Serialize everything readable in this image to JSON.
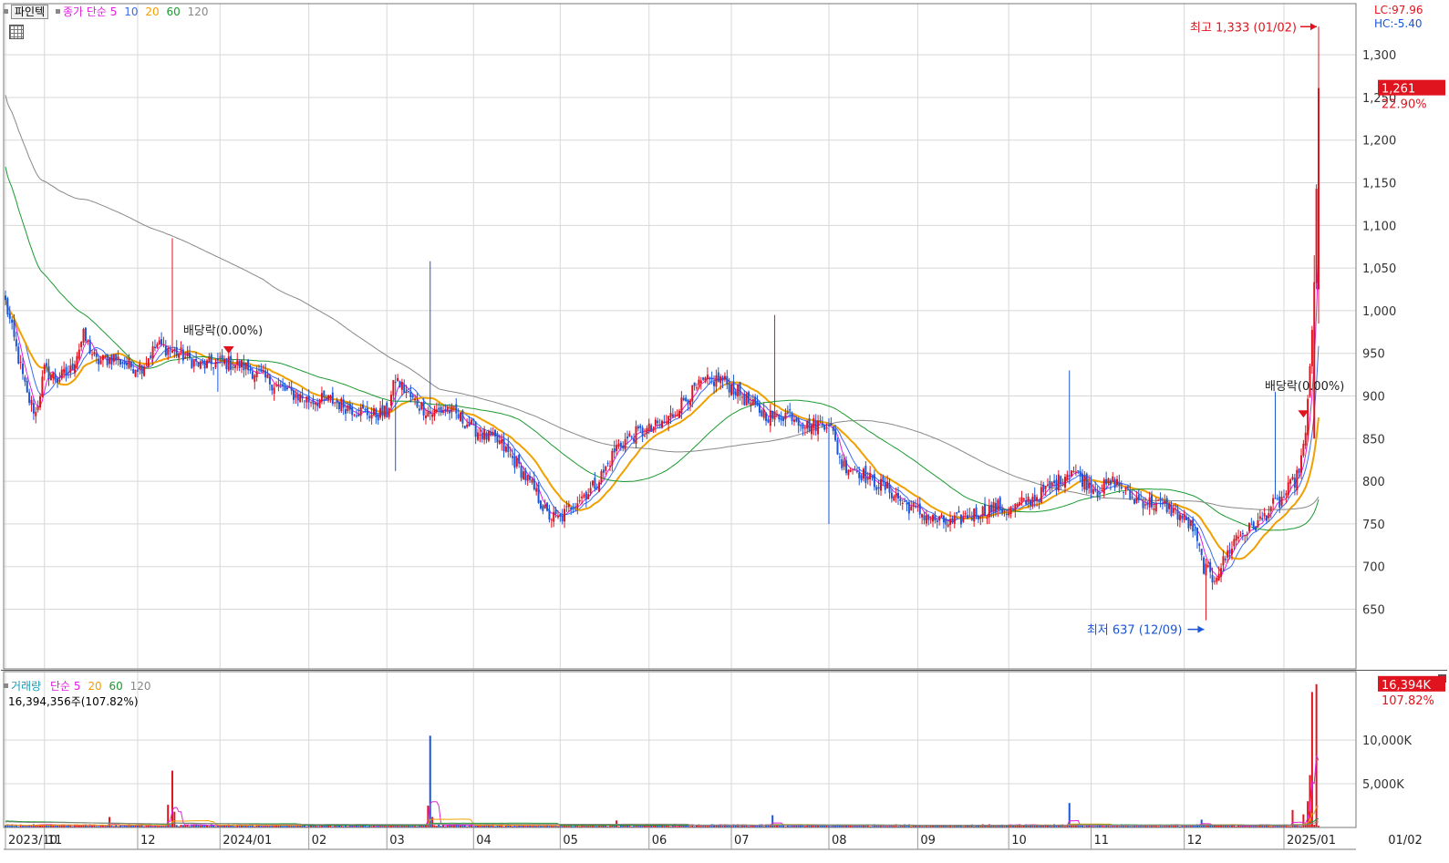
{
  "price_panel": {
    "tab_label": "파인텍",
    "legend_prefix": "종가 단순",
    "ma": [
      {
        "period": "5",
        "color": "#e020e0"
      },
      {
        "period": "10",
        "color": "#3a6cf0"
      },
      {
        "period": "20",
        "color": "#f0a000"
      },
      {
        "period": "60",
        "color": "#1a9a30"
      },
      {
        "period": "120",
        "color": "#888888"
      }
    ],
    "lc_text": "LC:97.96",
    "hc_text": "HC:-5.40",
    "current_price_label": "1,261",
    "current_change_label": "22.90%",
    "high_annotation": "최고 1,333 (01/02)",
    "low_annotation": "최저 637 (12/09)",
    "dividend_label_1": "배당락(0.00%)",
    "dividend_label_2": "배당락(0.00%)",
    "up_color": "#e0141e",
    "down_color": "#1a56d6"
  },
  "volume_panel": {
    "title": "거래량",
    "legend_prefix": "단순",
    "ma": [
      {
        "period": "5",
        "color": "#e020e0"
      },
      {
        "period": "20",
        "color": "#f0a000"
      },
      {
        "period": "60",
        "color": "#1a9a30"
      },
      {
        "period": "120",
        "color": "#888888"
      }
    ],
    "summary": "16,394,356주(107.82%)",
    "current_volume_label": "16,394K",
    "current_volume_change": "107.82%"
  },
  "chart_data": [
    {
      "type": "candlestick",
      "title": "파인텍",
      "y_ticks": [
        650,
        700,
        750,
        800,
        850,
        900,
        950,
        1000,
        1050,
        1100,
        1150,
        1200,
        1250,
        1300
      ],
      "y_tick_labels": [
        "650",
        "700",
        "750",
        "800",
        "850",
        "900",
        "950",
        "1,000",
        "1,050",
        "1,100",
        "1,150",
        "1,200",
        "1,250",
        "1,300"
      ],
      "ylim": [
        580,
        1360
      ],
      "x_tick_labels": [
        "2023/10",
        "11",
        "12",
        "2024/01",
        "02",
        "03",
        "04",
        "05",
        "06",
        "07",
        "08",
        "09",
        "10",
        "11",
        "12",
        "2025/01",
        "01/02"
      ],
      "x_ticks_index": [
        0,
        18,
        61,
        99,
        140,
        176,
        216,
        256,
        297,
        335,
        380,
        421,
        463,
        501,
        544,
        590,
        620
      ],
      "anchors": [
        [
          0,
          1010
        ],
        [
          5,
          955
        ],
        [
          10,
          900
        ],
        [
          14,
          880
        ],
        [
          18,
          930
        ],
        [
          24,
          920
        ],
        [
          30,
          930
        ],
        [
          36,
          970
        ],
        [
          42,
          940
        ],
        [
          50,
          945
        ],
        [
          58,
          935
        ],
        [
          63,
          935
        ],
        [
          70,
          960
        ],
        [
          80,
          950
        ],
        [
          90,
          935
        ],
        [
          100,
          940
        ],
        [
          110,
          935
        ],
        [
          120,
          920
        ],
        [
          130,
          905
        ],
        [
          140,
          895
        ],
        [
          150,
          895
        ],
        [
          160,
          885
        ],
        [
          170,
          878
        ],
        [
          176,
          880
        ],
        [
          180,
          920
        ],
        [
          188,
          895
        ],
        [
          196,
          880
        ],
        [
          204,
          885
        ],
        [
          212,
          870
        ],
        [
          220,
          855
        ],
        [
          228,
          845
        ],
        [
          236,
          820
        ],
        [
          244,
          790
        ],
        [
          250,
          760
        ],
        [
          256,
          755
        ],
        [
          262,
          775
        ],
        [
          270,
          790
        ],
        [
          276,
          810
        ],
        [
          282,
          840
        ],
        [
          290,
          855
        ],
        [
          297,
          860
        ],
        [
          305,
          870
        ],
        [
          313,
          895
        ],
        [
          322,
          915
        ],
        [
          330,
          920
        ],
        [
          338,
          905
        ],
        [
          346,
          885
        ],
        [
          354,
          875
        ],
        [
          362,
          880
        ],
        [
          370,
          865
        ],
        [
          380,
          870
        ],
        [
          386,
          820
        ],
        [
          392,
          815
        ],
        [
          400,
          800
        ],
        [
          408,
          790
        ],
        [
          414,
          775
        ],
        [
          421,
          765
        ],
        [
          428,
          755
        ],
        [
          436,
          750
        ],
        [
          444,
          760
        ],
        [
          452,
          765
        ],
        [
          458,
          770
        ],
        [
          463,
          765
        ],
        [
          470,
          775
        ],
        [
          478,
          785
        ],
        [
          486,
          800
        ],
        [
          492,
          815
        ],
        [
          498,
          800
        ],
        [
          504,
          790
        ],
        [
          512,
          800
        ],
        [
          520,
          780
        ],
        [
          528,
          775
        ],
        [
          536,
          770
        ],
        [
          542,
          760
        ],
        [
          548,
          745
        ],
        [
          553,
          700
        ],
        [
          557,
          685
        ],
        [
          562,
          705
        ],
        [
          568,
          735
        ],
        [
          575,
          745
        ],
        [
          580,
          755
        ],
        [
          584,
          770
        ],
        [
          588,
          775
        ],
        [
          592,
          790
        ],
        [
          596,
          805
        ],
        [
          600,
          850
        ],
        [
          604,
          1025
        ],
        [
          606,
          1261
        ]
      ],
      "high": {
        "value": 1333,
        "date": "01/02"
      },
      "low": {
        "value": 637,
        "date": "12/09"
      },
      "last": {
        "value": 1261,
        "change_pct": 22.9
      }
    },
    {
      "type": "bar",
      "title": "거래량",
      "y_ticks": [
        5000,
        10000
      ],
      "y_tick_labels": [
        "5,000K",
        "10,000K"
      ],
      "ylim": [
        0,
        17000
      ],
      "spikes": [
        {
          "index": 48,
          "value": 1200
        },
        {
          "index": 75,
          "value": 2600
        },
        {
          "index": 77,
          "value": 6500
        },
        {
          "index": 78,
          "value": 1800
        },
        {
          "index": 195,
          "value": 2500
        },
        {
          "index": 196,
          "value": 10500
        },
        {
          "index": 197,
          "value": 1200
        },
        {
          "index": 282,
          "value": 800
        },
        {
          "index": 354,
          "value": 1400
        },
        {
          "index": 491,
          "value": 2800
        },
        {
          "index": 552,
          "value": 900
        },
        {
          "index": 594,
          "value": 2000
        },
        {
          "index": 599,
          "value": 1500
        },
        {
          "index": 601,
          "value": 3000
        },
        {
          "index": 602,
          "value": 6000
        },
        {
          "index": 603,
          "value": 15500
        },
        {
          "index": 605,
          "value": 16394
        }
      ],
      "base_volume": 250
    }
  ]
}
